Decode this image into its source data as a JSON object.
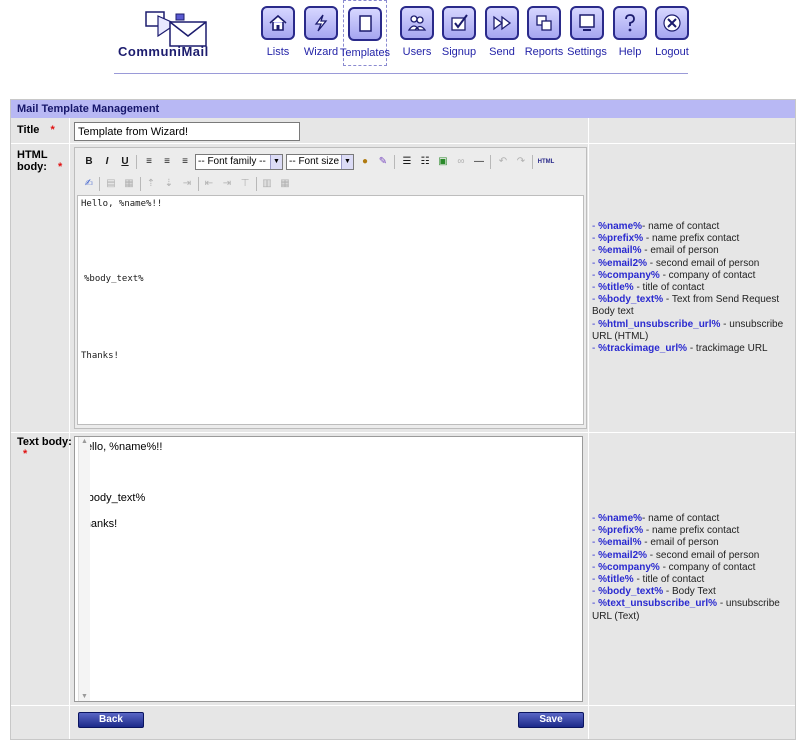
{
  "app": {
    "logo_text": "CommuniMail"
  },
  "nav": [
    {
      "id": "lists",
      "label": "Lists",
      "icon": "home-icon"
    },
    {
      "id": "wizard",
      "label": "Wizard",
      "icon": "lightning-icon"
    },
    {
      "id": "templates",
      "label": "Templates",
      "icon": "page-icon"
    },
    {
      "id": "users",
      "label": "Users",
      "icon": "users-icon"
    },
    {
      "id": "signup",
      "label": "Signup",
      "icon": "checkmark-icon"
    },
    {
      "id": "send",
      "label": "Send",
      "icon": "fast-forward-icon"
    },
    {
      "id": "reports",
      "label": "Reports",
      "icon": "reports-icon"
    },
    {
      "id": "settings",
      "label": "Settings",
      "icon": "monitor-icon"
    },
    {
      "id": "help",
      "label": "Help",
      "icon": "question-icon"
    },
    {
      "id": "logout",
      "label": "Logout",
      "icon": "close-icon"
    }
  ],
  "active_nav": "Templates",
  "panel": {
    "title": "Mail Template Management",
    "title_label": "Title",
    "html_label_line1": "HTML",
    "html_label_line2": "body:",
    "text_label": "Text body:",
    "required_mark": "*"
  },
  "form": {
    "title_value": "Template from Wizard!",
    "html_body_lines": [
      "Hello, %name%!!",
      "%body_text%",
      "Thanks!"
    ],
    "text_body_lines": [
      "Hello, %name%!!",
      "%body_text%",
      "Thanks!"
    ]
  },
  "toolbar": {
    "font_family": "-- Font family --",
    "font_size": "-- Font size --",
    "html_button": "HTML"
  },
  "html_variables": [
    {
      "var": "%name%",
      "desc": "- name of contact"
    },
    {
      "var": "%prefix%",
      "desc": " - name prefix contact"
    },
    {
      "var": "%email%",
      "desc": " - email of person"
    },
    {
      "var": "%email2%",
      "desc": " - second email of person"
    },
    {
      "var": "%company%",
      "desc": " - company of contact"
    },
    {
      "var": "%title%",
      "desc": " - title of contact"
    },
    {
      "var": "%body_text%",
      "desc": " - Text from Send Request Body text"
    },
    {
      "var": "%html_unsubscribe_url%",
      "desc": " - unsubscribe URL (HTML)"
    },
    {
      "var": "%trackimage_url%",
      "desc": " - trackimage URL"
    }
  ],
  "text_variables": [
    {
      "var": "%name%",
      "desc": "- name of contact"
    },
    {
      "var": "%prefix%",
      "desc": " - name prefix contact"
    },
    {
      "var": "%email%",
      "desc": " - email of person"
    },
    {
      "var": "%email2%",
      "desc": " - second email of person"
    },
    {
      "var": "%company%",
      "desc": " - company of contact"
    },
    {
      "var": "%title%",
      "desc": " - title of contact"
    },
    {
      "var": "%body_text%",
      "desc": " - Body Text"
    },
    {
      "var": "%text_unsubscribe_url%",
      "desc": " - unsubscribe URL (Text)"
    }
  ],
  "buttons": {
    "back": "Back",
    "save": "Save"
  },
  "colors": {
    "panel_header": "#b8b8f4",
    "nav_accent": "#2424a8",
    "variable": "#2a2ad0",
    "required": "#e01010"
  }
}
